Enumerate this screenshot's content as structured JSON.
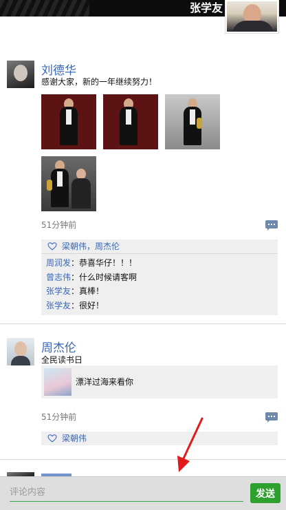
{
  "header": {
    "profile_name": "张学友"
  },
  "posts": [
    {
      "author": "刘德华",
      "text": "感谢大家，新的一年继续努力！",
      "time": "51分钟前",
      "likes": "梁朝伟，周杰伦",
      "comments": [
        {
          "user": "周润发",
          "sep": "：",
          "text": "恭喜华仔！！！"
        },
        {
          "user": "曾志伟",
          "sep": "：",
          "text": "什么时候请客啊"
        },
        {
          "user": "张学友",
          "sep": "：",
          "text": "真棒！"
        },
        {
          "user": "张学友",
          "sep": "：",
          "text": "很好！"
        }
      ]
    },
    {
      "author": "周杰伦",
      "text": "全民读书日",
      "share_text": "漂洋过海来看你",
      "time": "51分钟前",
      "likes": "梁朝伟"
    }
  ],
  "composer": {
    "placeholder": "评论内容",
    "value": "",
    "send_label": "发送"
  },
  "colors": {
    "link": "#3967b8",
    "send": "#2ea02e",
    "arrow": "#e0191c"
  },
  "icons": [
    "heart-icon",
    "comment-icon",
    "red-arrow"
  ]
}
